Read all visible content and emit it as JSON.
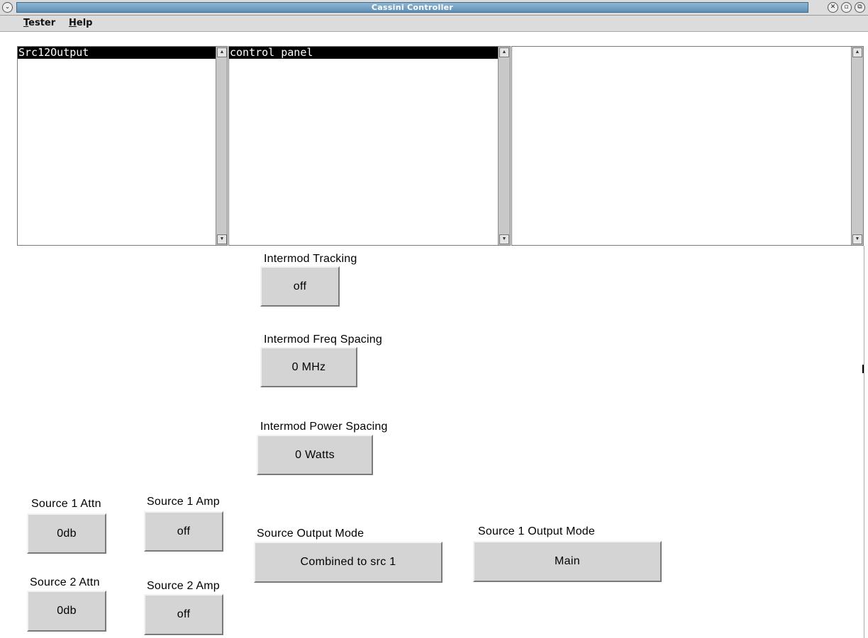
{
  "window": {
    "title": "Cassini Controller",
    "icons": {
      "menu": "chevron-down-icon",
      "close": "close-icon",
      "minimize": "minimize-icon",
      "maximize": "maximize-icon"
    }
  },
  "menubar": {
    "items": [
      {
        "label": "Tester"
      },
      {
        "label": "Help"
      }
    ]
  },
  "lists": {
    "left": {
      "selected": "Src12Output"
    },
    "middle": {
      "selected": "control panel"
    },
    "right": {
      "selected": ""
    }
  },
  "controls": {
    "intermod_tracking": {
      "label": "Intermod Tracking",
      "value": "off"
    },
    "intermod_freq_spacing": {
      "label": "Intermod Freq Spacing",
      "value": "0  MHz"
    },
    "intermod_power_spacing": {
      "label": "Intermod Power Spacing",
      "value": "0  Watts"
    },
    "source1_attn": {
      "label": "Source 1 Attn",
      "value": "0db"
    },
    "source1_amp": {
      "label": "Source 1 Amp",
      "value": "off"
    },
    "source2_attn": {
      "label": "Source 2 Attn",
      "value": "0db"
    },
    "source2_amp": {
      "label": "Source 2 Amp",
      "value": "off"
    },
    "source_output_mode": {
      "label": "Source Output Mode",
      "value": "Combined to src 1"
    },
    "source1_output_mode": {
      "label": "Source 1 Output Mode",
      "value": "Main"
    }
  }
}
